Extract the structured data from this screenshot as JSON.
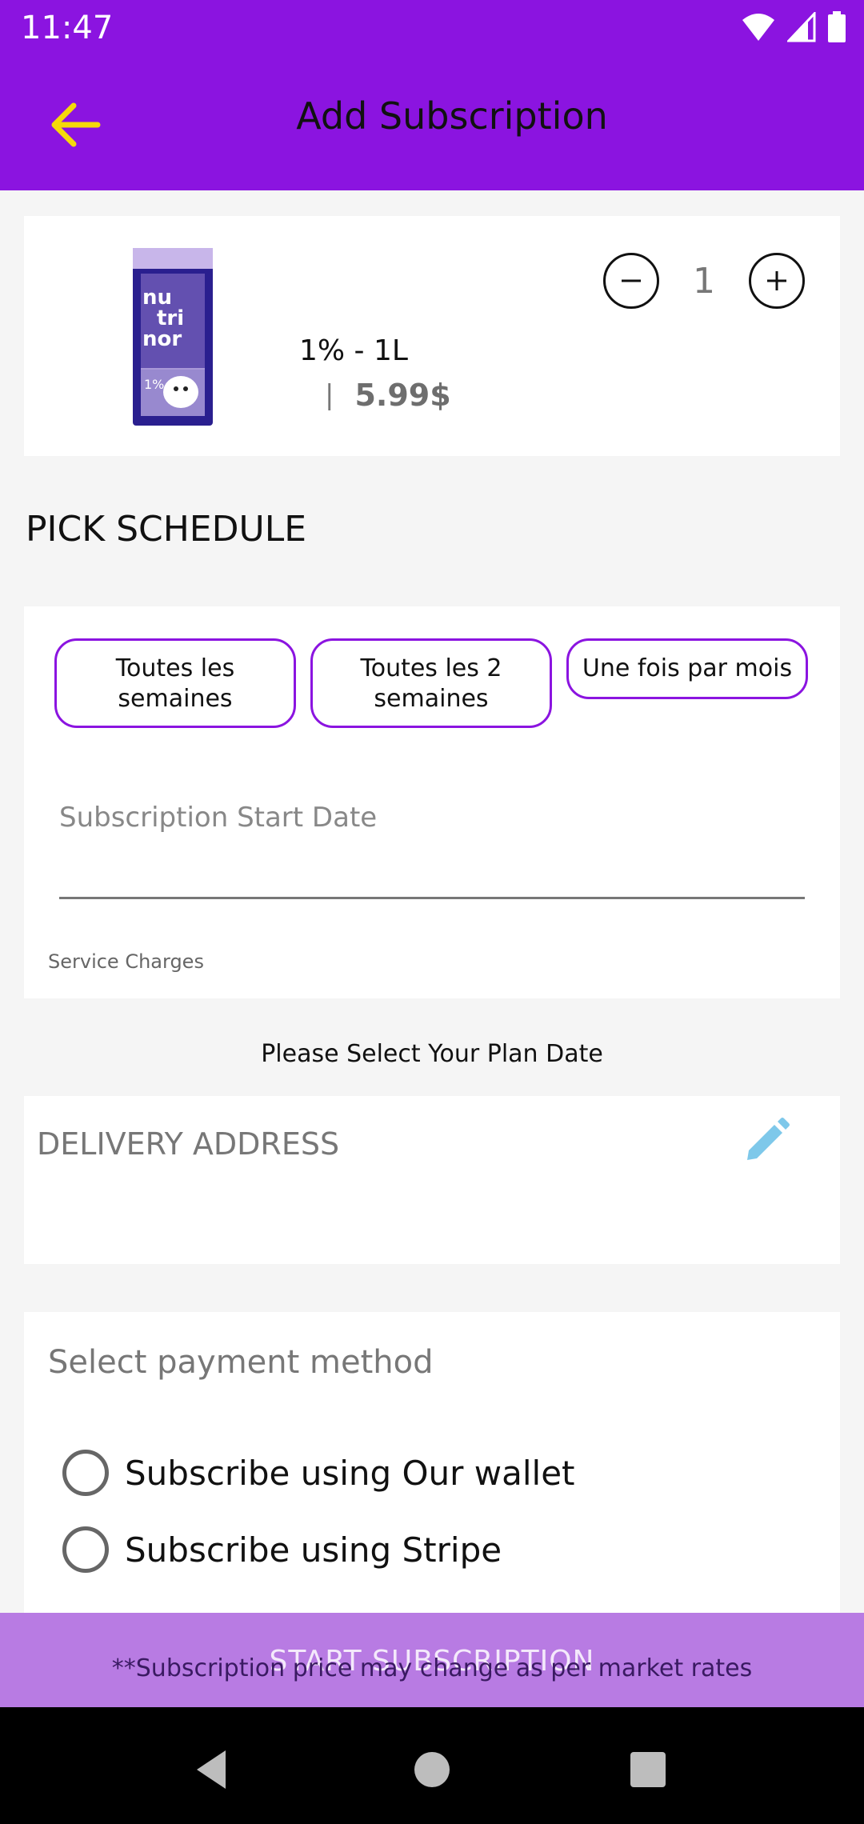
{
  "status_bar": {
    "time": "11:47"
  },
  "app_bar": {
    "title": "Add Subscription"
  },
  "product": {
    "name": "1% - 1L",
    "separator": "|",
    "price": "5.99$",
    "quantity": "1",
    "brand_text": "nu tri nor",
    "minus_symbol": "−",
    "plus_symbol": "+"
  },
  "schedule": {
    "title": "PICK SCHEDULE",
    "options": [
      "Toutes les semaines",
      "Toutes les 2 semaines",
      "Une fois par mois"
    ],
    "start_date_label": "Subscription Start Date",
    "start_date_value": "",
    "service_charges": "Service Charges"
  },
  "plan_note": "Please Select Your Plan Date",
  "delivery": {
    "label": "DELIVERY ADDRESS"
  },
  "payment": {
    "label": "Select payment method",
    "options": [
      "Subscribe using Our wallet",
      "Subscribe using Stripe"
    ]
  },
  "footer": {
    "start_button": "START SUBSCRIPTION",
    "disclaimer": "**Subscription price may change as per market rates"
  },
  "colors": {
    "primary": "#8b14e0",
    "back_arrow": "#f5d90a",
    "edit_icon": "#7ec8ea",
    "start_bar": "#b87be3"
  }
}
